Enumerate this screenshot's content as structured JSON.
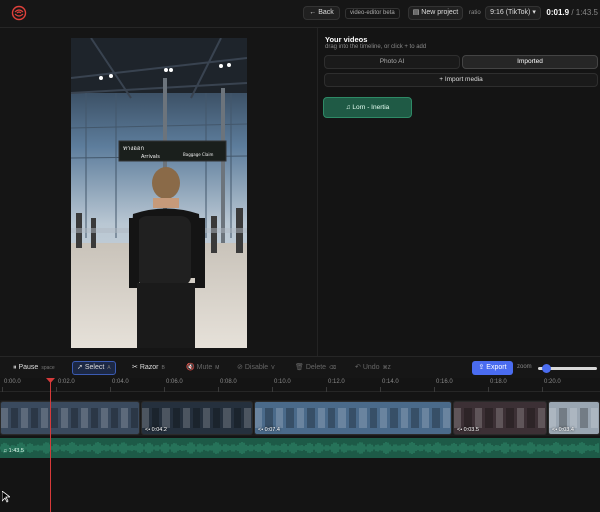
{
  "topbar": {
    "back_label": "Back",
    "app_tag": "video-editor beta",
    "new_project_label": "New project",
    "ratio_label": "ratio",
    "ratio_value": "9:16 (TikTok)",
    "time_current": "0:01.9",
    "time_total": "/ 1:43.5"
  },
  "media_panel": {
    "title": "Your videos",
    "subtitle": "drag into the timeline, or click + to add",
    "tabs": [
      {
        "label": "Photo AI",
        "active": false
      },
      {
        "label": "Imported",
        "active": true
      }
    ],
    "import_label": "Import media",
    "items": [
      {
        "label": "♫ Lorn - Inertia"
      }
    ]
  },
  "preview": {
    "sign_text_thai": "ทางออก",
    "sign_text_arrivals": "Arrivals",
    "sign_text_baggage": "Baggage Claim"
  },
  "toolbar": {
    "pause_label": "Pause",
    "pause_key": "space",
    "select_label": "Select",
    "select_key": "A",
    "razor_label": "Razor",
    "razor_key": "B",
    "mute_label": "Mute",
    "mute_key": "M",
    "disable_label": "Disable",
    "disable_key": "V",
    "delete_label": "Delete",
    "delete_key": "⌫",
    "undo_label": "Undo",
    "undo_key": "⌘Z",
    "export_label": "Export",
    "zoom_label": "zoom",
    "zoom_level": 0.1
  },
  "timeline": {
    "ticks": [
      "0:00.0",
      "0:02.0",
      "0:04.0",
      "0:06.0",
      "0:08.0",
      "0:10.0",
      "0:12.0",
      "0:14.0",
      "0:16.0",
      "0:18.0",
      "0:20.0"
    ],
    "clips": [
      {
        "label": "",
        "color": "#3a4a5e"
      },
      {
        "label": "<• 0:04.2",
        "color": "#25303d"
      },
      {
        "label": "<• 0:07.4",
        "color": "#4a6a8a"
      },
      {
        "label": "<• 0:03.5",
        "color": "#3c3035"
      },
      {
        "label": "<• 0:03.4",
        "color": "#9aa6b2"
      }
    ],
    "audio_label": "♫ 1:43.5"
  },
  "colors": {
    "accent": "#4a6cf0",
    "audio": "#1d5a47",
    "playhead": "#d63a3a"
  }
}
